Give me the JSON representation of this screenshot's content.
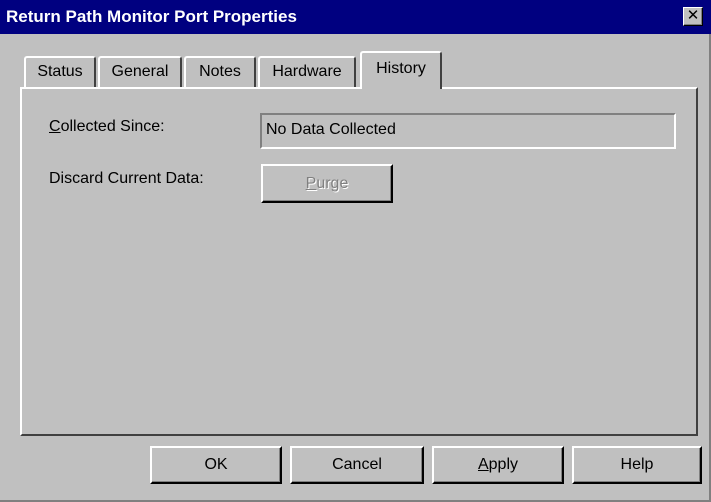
{
  "window": {
    "title": "Return Path Monitor Port Properties",
    "close_glyph": "✕"
  },
  "tabs": [
    {
      "label": "Status",
      "active": false
    },
    {
      "label": "General",
      "active": false
    },
    {
      "label": "Notes",
      "active": false
    },
    {
      "label": "Hardware",
      "active": false
    },
    {
      "label": "History",
      "active": true
    }
  ],
  "history": {
    "collected_since_label_mnemonic": "C",
    "collected_since_label_rest": "ollected Since:",
    "collected_since_value": "No Data Collected",
    "discard_label": "Discard Current Data:",
    "purge_mnemonic": "P",
    "purge_rest": "urge",
    "purge_enabled": false
  },
  "footer": {
    "ok_label": "OK",
    "cancel_label": "Cancel",
    "apply_mnemonic": "A",
    "apply_rest": "pply",
    "help_label": "Help"
  },
  "colors": {
    "face": "#c0c0c0",
    "titlebar": "#000080",
    "title_text": "#ffffff"
  }
}
